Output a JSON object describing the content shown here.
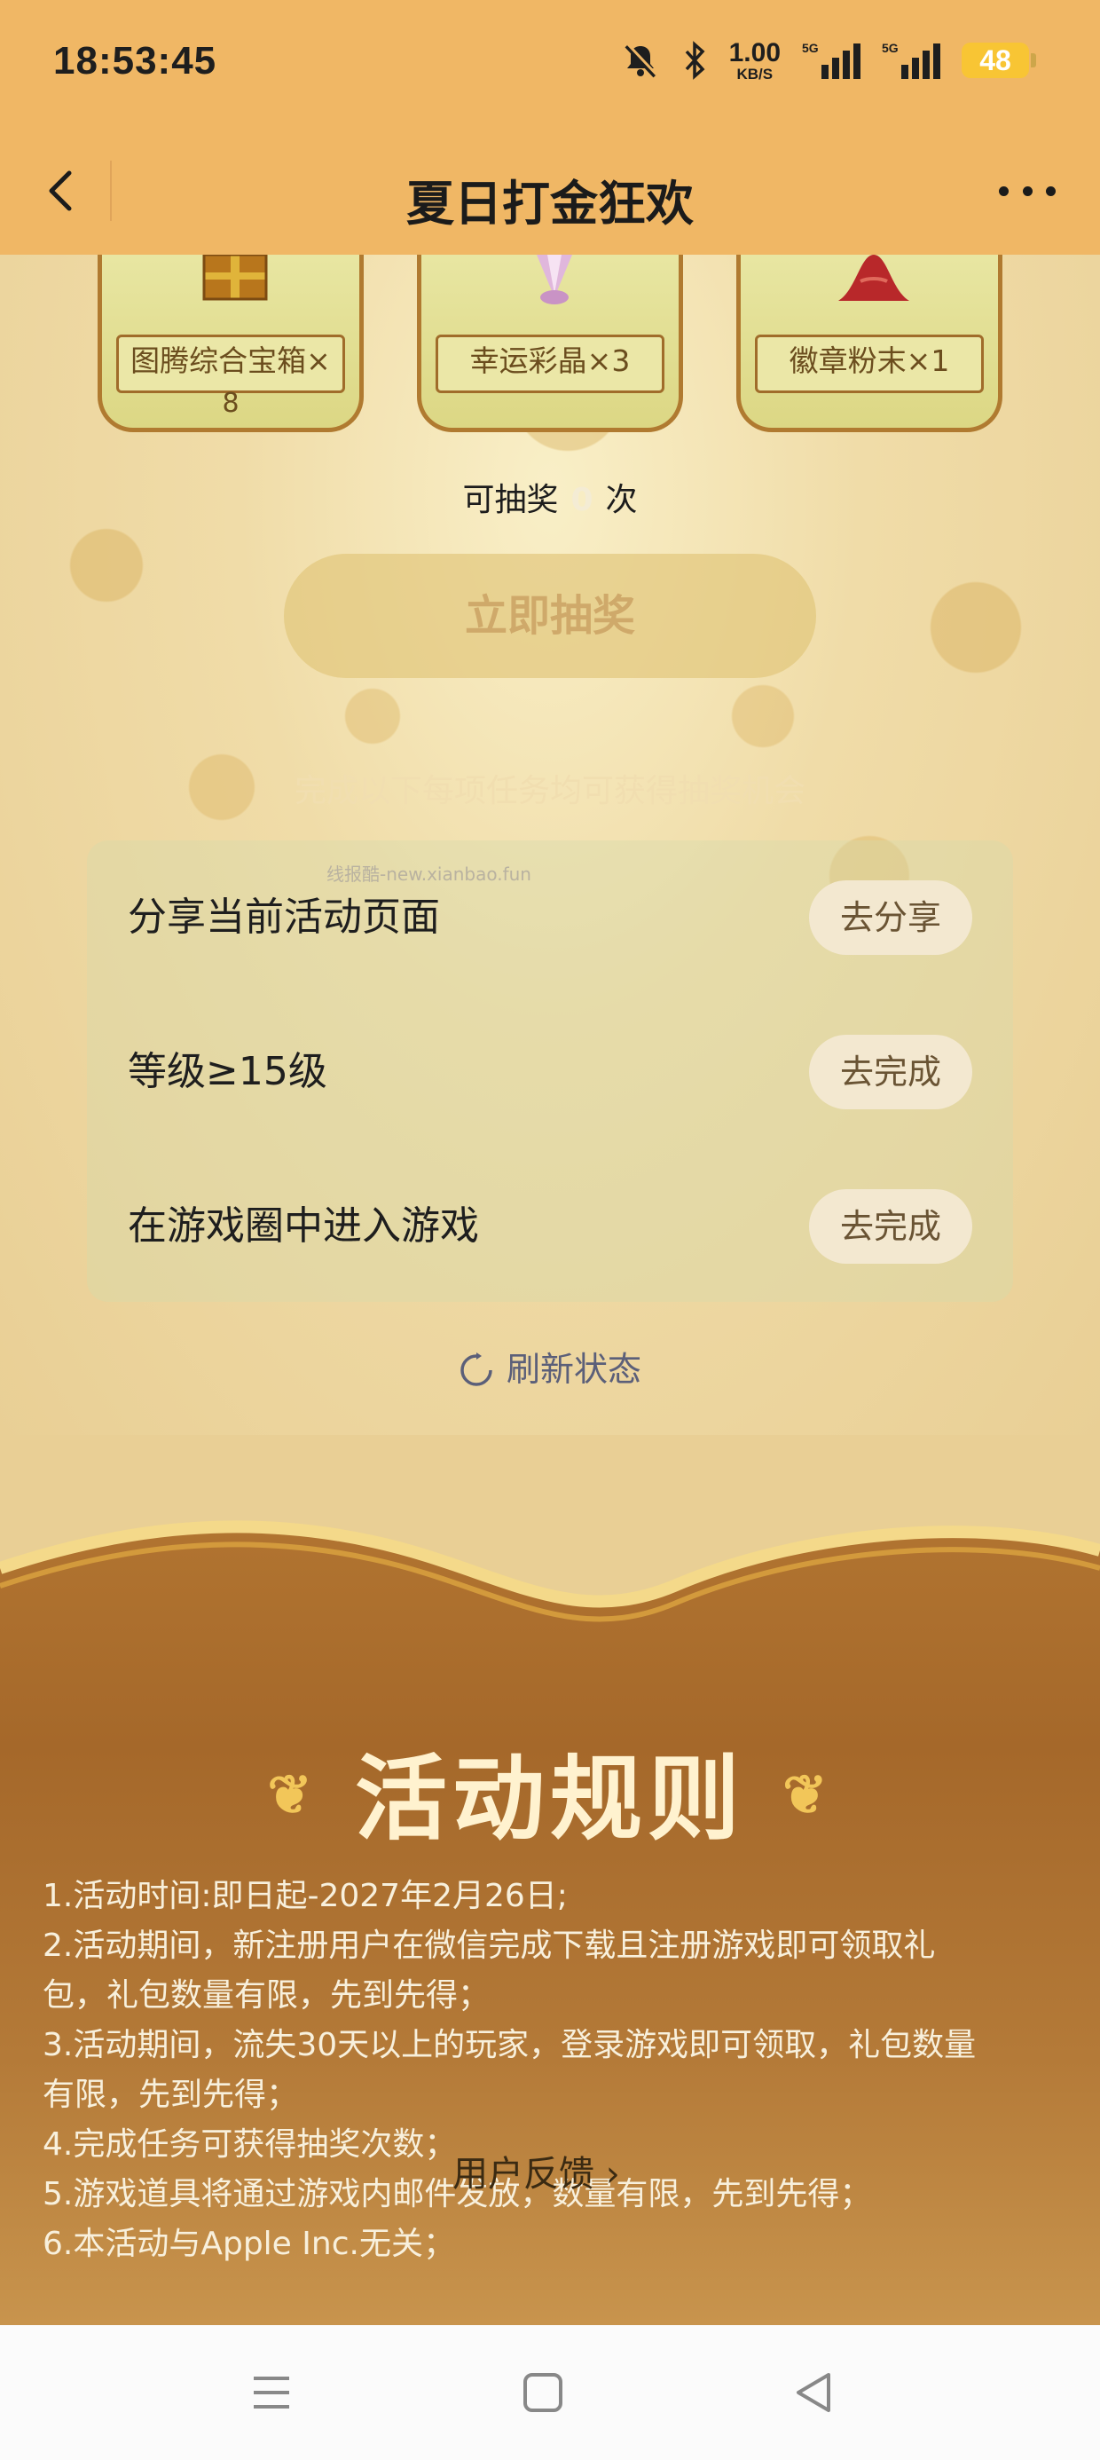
{
  "status_bar": {
    "time": "18:53:45",
    "net_speed_value": "1.00",
    "net_speed_unit": "KB/S",
    "signal1_label": "5G",
    "signal2_label": "5G",
    "battery": "48",
    "icons": [
      "mute-bell-icon",
      "bluetooth-icon",
      "signal-icon",
      "battery-icon"
    ]
  },
  "nav": {
    "title": "夏日打金狂欢",
    "icons": [
      "back-arrow-icon",
      "more-icon"
    ]
  },
  "prizes": [
    {
      "label": "图腾综合宝箱×",
      "label_line2": "8",
      "icon": "gift-box-icon"
    },
    {
      "label": "幸运彩晶×3",
      "label_line2": "",
      "icon": "crystal-icon"
    },
    {
      "label": "徽章粉末×1",
      "label_line2": "",
      "icon": "powder-icon"
    }
  ],
  "lottery": {
    "chances_prefix": "可抽奖",
    "chances_count": "0",
    "chances_suffix": "次",
    "draw_button": "立即抽奖"
  },
  "tasks_hint": "完成以下每项任务均可获得抽奖机会",
  "watermark": "线报酷-new.xianbao.fun",
  "tasks": [
    {
      "name": "分享当前活动页面",
      "button": "去分享"
    },
    {
      "name": "等级≥15级",
      "button": "去完成"
    },
    {
      "name": "在游戏圈中进入游戏",
      "button": "去完成"
    }
  ],
  "refresh_label": "刷新状态",
  "rules": {
    "title": "活动规则",
    "lines": [
      "1.活动时间:即日起-2027年2月26日;",
      "2.活动期间，新注册用户在微信完成下载且注册游戏即可领取礼",
      "包，礼包数量有限，先到先得；",
      "3.活动期间，流失30天以上的玩家，登录游戏即可领取，礼包数量",
      "有限，先到先得；",
      "4.完成任务可获得抽奖次数；",
      "5.游戏道具将通过游戏内邮件发放，数量有限，先到先得；",
      "6.本活动与Apple Inc.无关；"
    ],
    "feedback": "用户反馈 ›"
  },
  "system_nav": [
    "menu-icon",
    "home-icon",
    "back-triangle-icon"
  ],
  "colors": {
    "header": "#f0b765",
    "task_button_bg": "#f3e8d0",
    "rules_bg": "#a5682a"
  }
}
